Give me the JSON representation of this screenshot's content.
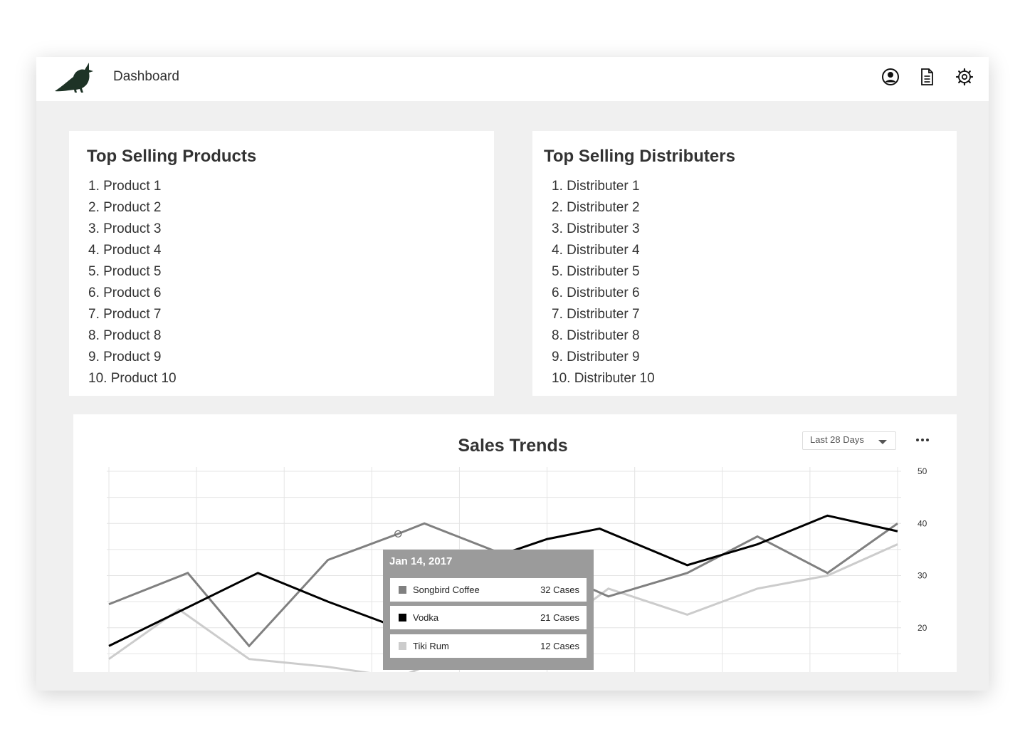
{
  "header": {
    "title": "Dashboard",
    "icons": [
      "user-icon",
      "document-icon",
      "gear-icon"
    ]
  },
  "products": {
    "title": "Top Selling Products",
    "items": [
      "1. Product 1",
      "2. Product 2",
      "3. Product 3",
      "4. Product 4",
      "5. Product 5",
      "6. Product 6",
      "7. Product 7",
      "8. Product 8",
      "9. Product 9",
      "10. Product 10"
    ]
  },
  "distributors": {
    "title": "Top Selling Distributers",
    "items": [
      "1. Distributer 1",
      "2. Distributer 2",
      "3. Distributer 3",
      "4. Distributer 4",
      "5. Distributer 5",
      "6. Distributer 6",
      "7. Distributer 7",
      "8. Distributer 8",
      "9. Distributer 9",
      "10. Distributer 10"
    ]
  },
  "sales": {
    "title": "Sales Trends",
    "range_label": "Last 28 Days",
    "tooltip": {
      "date": "Jan 14, 2017",
      "rows": [
        {
          "name": "Songbird Coffee",
          "value": "32 Cases",
          "color": "#808080"
        },
        {
          "name": "Vodka",
          "value": "21 Cases",
          "color": "#000000"
        },
        {
          "name": "Tiki Rum",
          "value": "12 Cases",
          "color": "#cccccc"
        }
      ]
    }
  },
  "chart_data": {
    "type": "line",
    "title": "Sales Trends",
    "ylim": [
      10,
      50
    ],
    "yticks": [
      20,
      30,
      40,
      50
    ],
    "grid": true,
    "series": [
      {
        "name": "Songbird Coffee",
        "color": "#808080",
        "points": [
          [
            0,
            24.5
          ],
          [
            0.9,
            30.5
          ],
          [
            1.6,
            16.5
          ],
          [
            2.5,
            33
          ],
          [
            3.3,
            38
          ],
          [
            3.6,
            40
          ],
          [
            5.5,
            27.5
          ],
          [
            5.7,
            26
          ],
          [
            6.6,
            30.5
          ],
          [
            7.4,
            37.5
          ],
          [
            8.2,
            30.5
          ],
          [
            9.0,
            40
          ]
        ]
      },
      {
        "name": "Vodka",
        "color": "#000000",
        "points": [
          [
            0,
            16.5
          ],
          [
            1.7,
            30.5
          ],
          [
            2.5,
            25
          ],
          [
            3.3,
            20
          ],
          [
            4.3,
            33
          ],
          [
            5.0,
            37
          ],
          [
            5.6,
            39
          ],
          [
            6.6,
            32
          ],
          [
            7.4,
            36
          ],
          [
            8.2,
            41.5
          ],
          [
            9.0,
            38.5
          ]
        ]
      },
      {
        "name": "Tiki Rum",
        "color": "#cccccc",
        "points": [
          [
            0,
            14
          ],
          [
            0.8,
            23.5
          ],
          [
            1.6,
            14
          ],
          [
            2.5,
            12.5
          ],
          [
            3.3,
            10.5
          ],
          [
            5.5,
            25
          ],
          [
            5.7,
            27.5
          ],
          [
            6.6,
            22.5
          ],
          [
            7.4,
            27.5
          ],
          [
            8.2,
            30
          ],
          [
            9.0,
            36
          ]
        ]
      }
    ]
  }
}
